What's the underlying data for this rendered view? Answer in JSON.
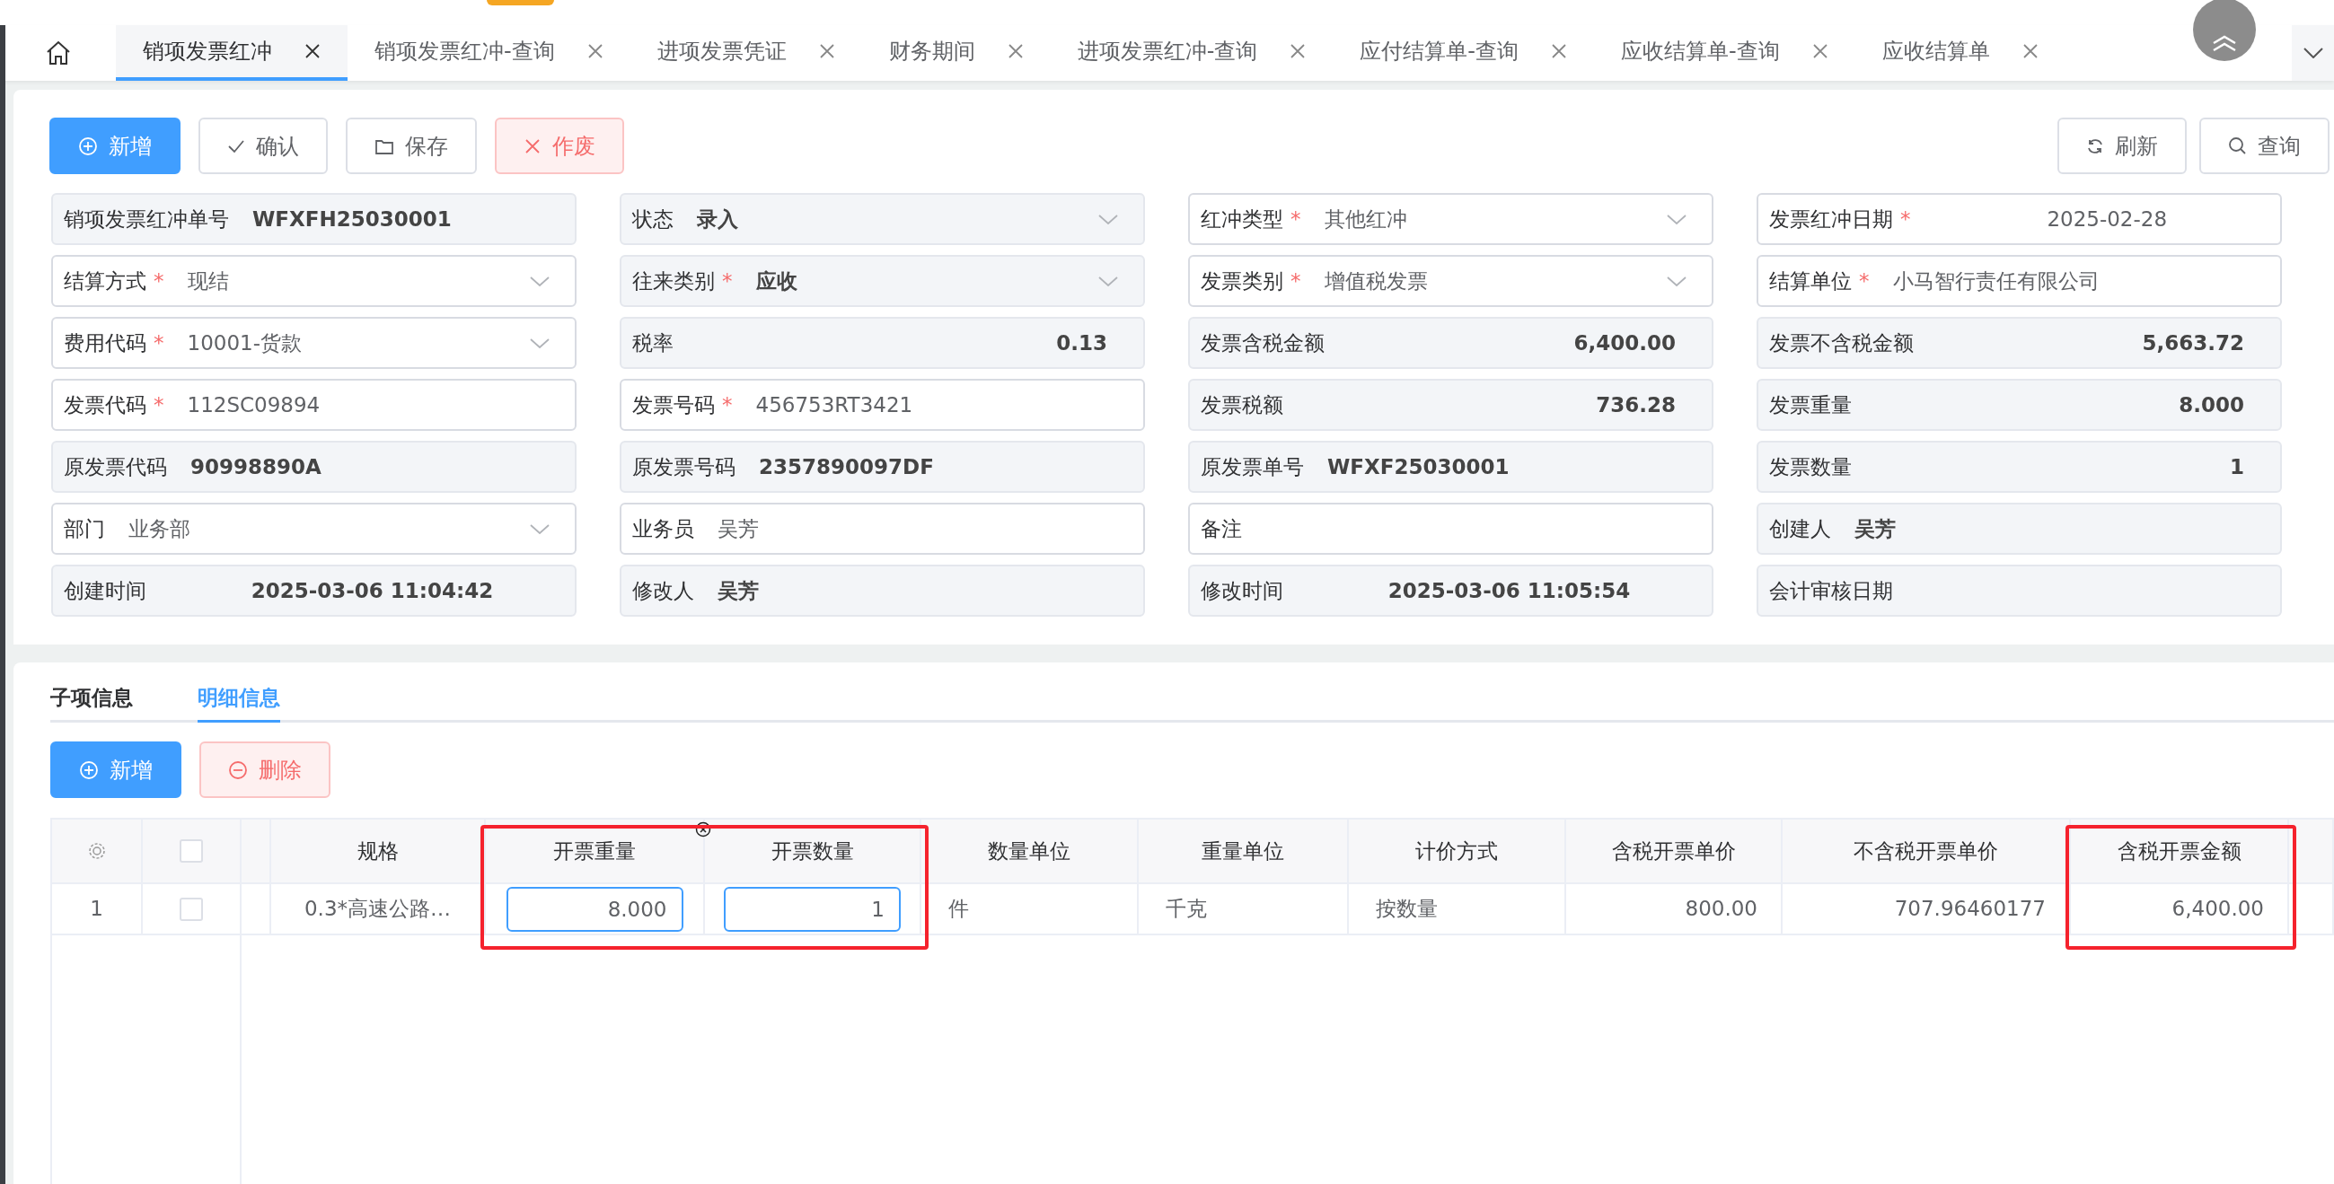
{
  "tabs": [
    {
      "label": "销项发票红冲",
      "selected": true
    },
    {
      "label": "销项发票红冲-查询",
      "selected": false
    },
    {
      "label": "进项发票凭证",
      "selected": false
    },
    {
      "label": "财务期间",
      "selected": false
    },
    {
      "label": "进项发票红冲-查询",
      "selected": false
    },
    {
      "label": "应付结算单-查询",
      "selected": false
    },
    {
      "label": "应收结算单-查询",
      "selected": false
    },
    {
      "label": "应收结算单",
      "selected": false
    }
  ],
  "toolbar": {
    "left": [
      {
        "label": "新增",
        "kind": "add"
      },
      {
        "label": "确认",
        "kind": "confirm"
      },
      {
        "label": "保存",
        "kind": "save"
      },
      {
        "label": "作废",
        "kind": "void"
      }
    ],
    "right": [
      {
        "label": "刷新",
        "kind": "refresh"
      },
      {
        "label": "查询",
        "kind": "query"
      }
    ]
  },
  "form": {
    "fields": [
      {
        "label": "销项发票红冲单号",
        "value": "WFXFH25030001",
        "kind": "text",
        "disabled": true
      },
      {
        "label": "状态",
        "value": "录入",
        "kind": "select",
        "disabled": true
      },
      {
        "label": "红冲类型",
        "required_mark": "*",
        "value": "其他红冲",
        "kind": "select",
        "disabled": false
      },
      {
        "label": "发票红冲日期",
        "required_mark": "*",
        "value": "2025-02-28",
        "kind": "date",
        "disabled": false
      },
      {
        "label": "结算方式",
        "required_mark": "*",
        "value": "现结",
        "kind": "select",
        "disabled": false
      },
      {
        "label": "往来类别",
        "required_mark": "*",
        "value": "应收",
        "kind": "select",
        "disabled": true
      },
      {
        "label": "发票类别",
        "required_mark": "*",
        "value": "增值税发票",
        "kind": "select",
        "disabled": false
      },
      {
        "label": "结算单位",
        "required_mark": "*",
        "value": "小马智行责任有限公司",
        "kind": "text",
        "disabled": false
      },
      {
        "label": "费用代码",
        "required_mark": "*",
        "value": "10001-货款",
        "kind": "select",
        "disabled": false
      },
      {
        "label": "税率",
        "value": "0.13",
        "kind": "number",
        "disabled": true
      },
      {
        "label": "发票含税金额",
        "value": "6,400.00",
        "kind": "number",
        "disabled": true
      },
      {
        "label": "发票不含税金额",
        "value": "5,663.72",
        "kind": "number",
        "disabled": true
      },
      {
        "label": "发票代码",
        "required_mark": "*",
        "value": "112SC09894",
        "kind": "text",
        "disabled": false
      },
      {
        "label": "发票号码",
        "required_mark": "*",
        "value": "456753RT3421",
        "kind": "text",
        "disabled": false
      },
      {
        "label": "发票税额",
        "value": "736.28",
        "kind": "number",
        "disabled": true
      },
      {
        "label": "发票重量",
        "value": "8.000",
        "kind": "number",
        "disabled": true
      },
      {
        "label": "原发票代码",
        "value": "90998890A",
        "kind": "text",
        "disabled": true
      },
      {
        "label": "原发票号码",
        "value": "2357890097DF",
        "kind": "text",
        "disabled": true
      },
      {
        "label": "原发票单号",
        "value": "WFXF25030001",
        "kind": "text",
        "disabled": true
      },
      {
        "label": "发票数量",
        "value": "1",
        "kind": "number",
        "disabled": true
      },
      {
        "label": "部门",
        "value": "业务部",
        "kind": "select",
        "disabled": false
      },
      {
        "label": "业务员",
        "value": "吴芳",
        "kind": "text",
        "disabled": false
      },
      {
        "label": "备注",
        "kind": "text",
        "disabled": false
      },
      {
        "label": "创建人",
        "value": "吴芳",
        "kind": "text",
        "disabled": true
      },
      {
        "label": "创建时间",
        "value": "2025-03-06 11:04:42",
        "kind": "date",
        "disabled": true
      },
      {
        "label": "修改人",
        "value": "吴芳",
        "kind": "text",
        "disabled": true
      },
      {
        "label": "修改时间",
        "value": "2025-03-06 11:05:54",
        "kind": "date",
        "disabled": true
      },
      {
        "label": "会计审核日期",
        "kind": "text",
        "disabled": true
      }
    ]
  },
  "detail": {
    "tabs": [
      {
        "label": "子项信息",
        "selected": false
      },
      {
        "label": "明细信息",
        "selected": true
      }
    ],
    "buttons": [
      {
        "label": "新增",
        "kind": "add"
      },
      {
        "label": "删除",
        "kind": "delete"
      }
    ],
    "columns": [
      {
        "header": "规格",
        "kind": "text",
        "highlighted": false
      },
      {
        "header": "开票重量",
        "kind": "number",
        "highlighted": true
      },
      {
        "header": "开票数量",
        "kind": "number",
        "highlighted": true
      },
      {
        "header": "数量单位",
        "kind": "unit",
        "highlighted": false
      },
      {
        "header": "重量单位",
        "kind": "unit",
        "highlighted": false
      },
      {
        "header": "计价方式",
        "kind": "unit",
        "highlighted": false
      },
      {
        "header": "含税开票单价",
        "kind": "number",
        "highlighted": false
      },
      {
        "header": "不含税开票单价",
        "kind": "number",
        "highlighted": false
      },
      {
        "header": "含税开票金额",
        "kind": "number",
        "highlighted": true
      }
    ],
    "header_checked": false,
    "rows": [
      {
        "index": "1",
        "checked": false,
        "cells": [
          {
            "value": "0.3*高速公路…",
            "kind": "text"
          },
          {
            "value": "8.000",
            "kind": "input"
          },
          {
            "value": "1",
            "kind": "input"
          },
          {
            "value": "件",
            "kind": "text"
          },
          {
            "value": "千克",
            "kind": "text"
          },
          {
            "value": "按数量",
            "kind": "text"
          },
          {
            "value": "800.00",
            "kind": "text"
          },
          {
            "value": "707.96460177",
            "kind": "text"
          },
          {
            "value": "6,400.00",
            "kind": "text"
          }
        ]
      }
    ]
  }
}
